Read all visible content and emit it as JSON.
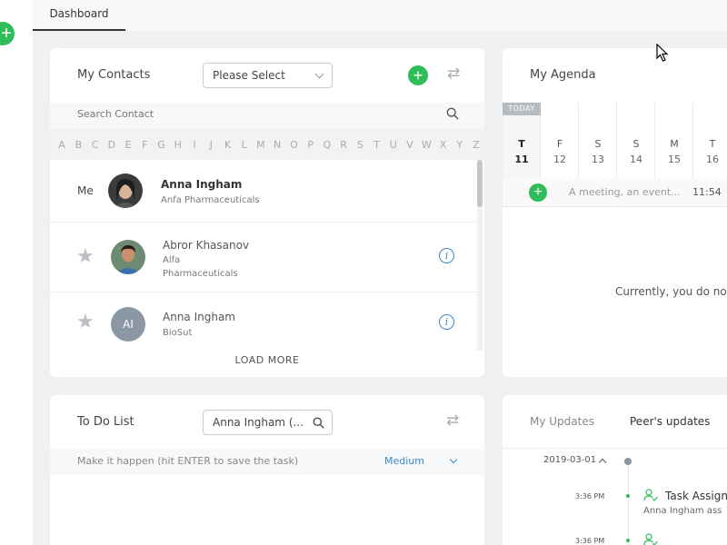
{
  "colors": {
    "accent_green": "#2ebd59",
    "link_blue": "#3a89c9",
    "muted": "#aaaaaa"
  },
  "nav": {
    "tab": "Dashboard"
  },
  "contacts": {
    "title": "My Contacts",
    "select_value": "Please Select",
    "search_placeholder": "Search Contact",
    "alphabet": [
      "A",
      "B",
      "C",
      "D",
      "E",
      "F",
      "G",
      "H",
      "I",
      "J",
      "K",
      "L",
      "M",
      "N",
      "O",
      "P",
      "Q",
      "R",
      "S",
      "T",
      "U",
      "V",
      "W",
      "X",
      "Y",
      "Z"
    ],
    "me_label": "Me",
    "me": {
      "name": "Anna Ingham",
      "company": "Anfa Pharmaceuticals"
    },
    "items": [
      {
        "name": "Abror Khasanov",
        "company_line1": "Alfa",
        "company_line2": "Pharmaceuticals"
      },
      {
        "name": "Anna Ingham",
        "company_line1": "BioSut",
        "initials": "AI"
      }
    ],
    "load_more": "LOAD MORE"
  },
  "agenda": {
    "title": "My Agenda",
    "today_label": "TODAY",
    "days": [
      {
        "letter": "T",
        "num": "11"
      },
      {
        "letter": "F",
        "num": "12"
      },
      {
        "letter": "S",
        "num": "13"
      },
      {
        "letter": "S",
        "num": "14"
      },
      {
        "letter": "M",
        "num": "15"
      },
      {
        "letter": "T",
        "num": "16"
      }
    ],
    "event_placeholder": "A meeting, an event...",
    "event_time": "11:54",
    "empty_message": "Currently, you do not"
  },
  "todo": {
    "title": "To Do List",
    "search_value": "Anna Ingham (...",
    "input_placeholder": "Make it happen (hit ENTER to save the task)",
    "priority": "Medium"
  },
  "updates": {
    "tab_my": "My Updates",
    "tab_peers": "Peer's updates",
    "date": "2019-03-01",
    "entries": [
      {
        "time": "3:36 PM",
        "title": "Task Assign",
        "sub": "Anna Ingham ass"
      },
      {
        "time": "3:36 PM"
      }
    ]
  }
}
